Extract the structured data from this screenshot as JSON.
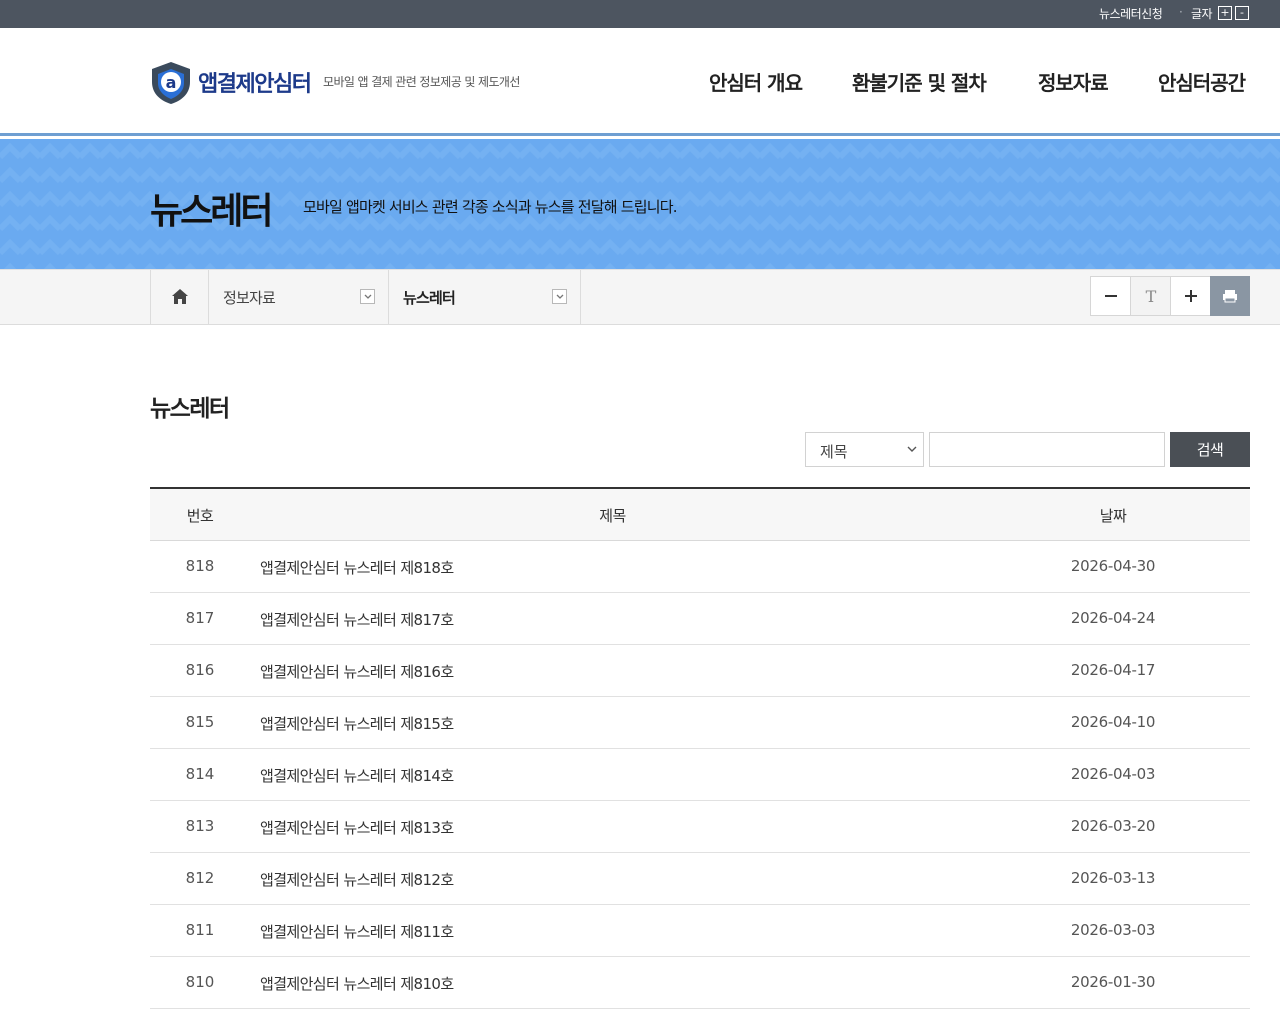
{
  "topbar": {
    "newsletter_signup": "뉴스레터신청",
    "separator": "·",
    "font_size_label": "글자",
    "font_plus": "+",
    "font_minus": "-"
  },
  "header": {
    "logo_name": "앱결제안심터",
    "logo_subtitle": "모바일 앱 결제 관련 정보제공 및 제도개선",
    "nav": [
      "안심터 개요",
      "환불기준 및 절차",
      "정보자료",
      "안심터공간"
    ]
  },
  "banner": {
    "title": "뉴스레터",
    "description": "모바일 앱마켓 서비스 관련 각종 소식과 뉴스를 전달해 드립니다."
  },
  "location": {
    "home_icon": "home-icon",
    "depth1": "정보자료",
    "depth2": "뉴스레터",
    "tools": [
      "minus-icon",
      "text-size-icon",
      "plus-icon",
      "print-icon"
    ]
  },
  "content": {
    "heading": "뉴스레터",
    "search": {
      "select_value": "제목",
      "input_value": "",
      "button_label": "검색"
    },
    "table": {
      "headers": [
        "번호",
        "제목",
        "날짜"
      ],
      "rows": [
        {
          "num": "818",
          "title": "앱결제안심터 뉴스레터 제818호",
          "date": "2026-04-30"
        },
        {
          "num": "817",
          "title": "앱결제안심터 뉴스레터 제817호",
          "date": "2026-04-24"
        },
        {
          "num": "816",
          "title": "앱결제안심터 뉴스레터 제816호",
          "date": "2026-04-17"
        },
        {
          "num": "815",
          "title": "앱결제안심터 뉴스레터 제815호",
          "date": "2026-04-10"
        },
        {
          "num": "814",
          "title": "앱결제안심터 뉴스레터 제814호",
          "date": "2026-04-03"
        },
        {
          "num": "813",
          "title": "앱결제안심터 뉴스레터 제813호",
          "date": "2026-03-20"
        },
        {
          "num": "812",
          "title": "앱결제안심터 뉴스레터 제812호",
          "date": "2026-03-13"
        },
        {
          "num": "811",
          "title": "앱결제안심터 뉴스레터 제811호",
          "date": "2026-03-03"
        },
        {
          "num": "810",
          "title": "앱결제안심터 뉴스레터 제810호",
          "date": "2026-01-30"
        }
      ]
    }
  },
  "colors": {
    "topbar_bg": "#4d5560",
    "banner_bg": "#6aaaf0",
    "logo_blue": "#1d3a8a",
    "search_button_bg": "#4a4f55",
    "print_button_bg": "#8a96a3"
  }
}
